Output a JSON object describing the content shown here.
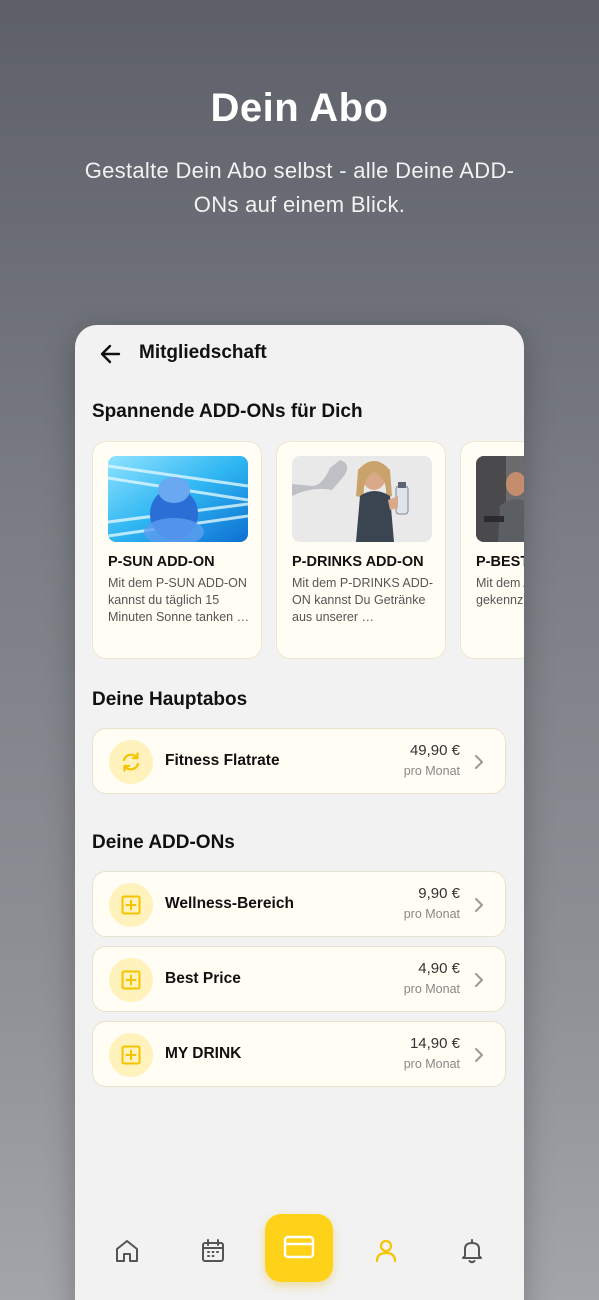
{
  "promo": {
    "title": "Dein Abo",
    "subtitle": "Gestalte Dein Abo selbst - alle Deine ADD-ONs auf einem Blick."
  },
  "header": {
    "title": "Mitgliedschaft",
    "back_icon": "arrow-left-icon"
  },
  "addons_section": {
    "title": "Spannende ADD-ONs für Dich",
    "cards": [
      {
        "name": "P-SUN ADD-ON",
        "description": "Mit dem P-SUN ADD-ON kannst du täglich 15 Minuten Sonne tanken …"
      },
      {
        "name": "P-DRINKS ADD-ON",
        "description": "Mit dem P-DRINKS ADD-ON kannst Du Getränke aus unserer …"
      },
      {
        "name": "P-BEST ADD-ON",
        "description": "Mit dem ADD-ON gekennz…"
      }
    ]
  },
  "main_section": {
    "title": "Deine Hauptabos",
    "items": [
      {
        "label": "Fitness Flatrate",
        "price": "49,90 €",
        "period": "pro Monat",
        "icon": "refresh-icon"
      }
    ]
  },
  "my_addons_section": {
    "title": "Deine ADD-ONs",
    "items": [
      {
        "label": "Wellness-Bereich",
        "price": "9,90 €",
        "period": "pro Monat",
        "icon": "plus-square-icon"
      },
      {
        "label": "Best Price",
        "price": "4,90 €",
        "period": "pro Monat",
        "icon": "plus-square-icon"
      },
      {
        "label": "MY DRINK",
        "price": "14,90 €",
        "period": "pro Monat",
        "icon": "plus-square-icon"
      }
    ]
  },
  "bottom_nav": {
    "items": [
      "home-icon",
      "calendar-icon",
      "card-icon",
      "user-icon",
      "bell-icon"
    ],
    "active": "user-icon"
  },
  "colors": {
    "accent": "#ffd21a",
    "accent_soft": "#fff2bd",
    "card_bg": "#fffdf4"
  }
}
